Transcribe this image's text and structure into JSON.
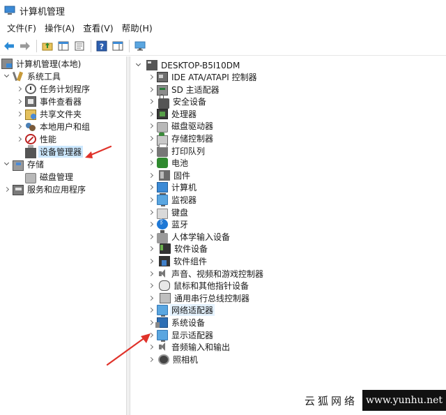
{
  "window": {
    "title": "计算机管理"
  },
  "menu": [
    {
      "id": "file",
      "label": "文件(F)"
    },
    {
      "id": "action",
      "label": "操作(A)"
    },
    {
      "id": "view",
      "label": "查看(V)"
    },
    {
      "id": "help",
      "label": "帮助(H)"
    }
  ],
  "toolbar": {
    "icons": [
      "back-arrow-icon",
      "forward-arrow-icon",
      "up-folder-icon",
      "show-hide-tree-icon",
      "properties-icon",
      "help-icon",
      "action-pane-icon",
      "monitor-icon"
    ]
  },
  "left_tree": {
    "root": "计算机管理(本地)",
    "system_tools": "系统工具",
    "task_scheduler": "任务计划程序",
    "event_viewer": "事件查看器",
    "shared_folders": "共享文件夹",
    "local_users": "本地用户和组",
    "performance": "性能",
    "device_manager": "设备管理器",
    "storage": "存储",
    "disk_management": "磁盘管理",
    "services_apps": "服务和应用程序"
  },
  "device_tree": {
    "computer_name": "DESKTOP-B5I10DM",
    "categories": [
      {
        "label": "IDE ATA/ATAPI 控制器",
        "icon": "ide-controller-icon"
      },
      {
        "label": "SD 主适配器",
        "icon": "sd-adapter-icon"
      },
      {
        "label": "安全设备",
        "icon": "security-device-icon"
      },
      {
        "label": "处理器",
        "icon": "processor-icon"
      },
      {
        "label": "磁盘驱动器",
        "icon": "disk-drive-icon"
      },
      {
        "label": "存储控制器",
        "icon": "storage-controller-icon"
      },
      {
        "label": "打印队列",
        "icon": "print-queue-icon"
      },
      {
        "label": "电池",
        "icon": "battery-icon"
      },
      {
        "label": "固件",
        "icon": "firmware-icon"
      },
      {
        "label": "计算机",
        "icon": "computer-icon"
      },
      {
        "label": "监视器",
        "icon": "monitor-icon"
      },
      {
        "label": "键盘",
        "icon": "keyboard-icon"
      },
      {
        "label": "蓝牙",
        "icon": "bluetooth-icon"
      },
      {
        "label": "人体学输入设备",
        "icon": "hid-icon"
      },
      {
        "label": "软件设备",
        "icon": "software-device-icon"
      },
      {
        "label": "软件组件",
        "icon": "software-component-icon"
      },
      {
        "label": "声音、视频和游戏控制器",
        "icon": "sound-icon"
      },
      {
        "label": "鼠标和其他指针设备",
        "icon": "mouse-icon"
      },
      {
        "label": "通用串行总线控制器",
        "icon": "usb-icon"
      },
      {
        "label": "网络适配器",
        "icon": "network-adapter-icon"
      },
      {
        "label": "系统设备",
        "icon": "system-device-icon"
      },
      {
        "label": "显示适配器",
        "icon": "display-adapter-icon"
      },
      {
        "label": "音频输入和输出",
        "icon": "audio-io-icon"
      },
      {
        "label": "照相机",
        "icon": "camera-icon"
      }
    ]
  },
  "watermark": {
    "site_cn": "云狐网络",
    "site_url": "www.yunhu.net"
  },
  "colors": {
    "selection": "#cce8ff",
    "hover": "#e5f3ff",
    "arrow": "#e0322a",
    "accent": "#1e78d6"
  }
}
